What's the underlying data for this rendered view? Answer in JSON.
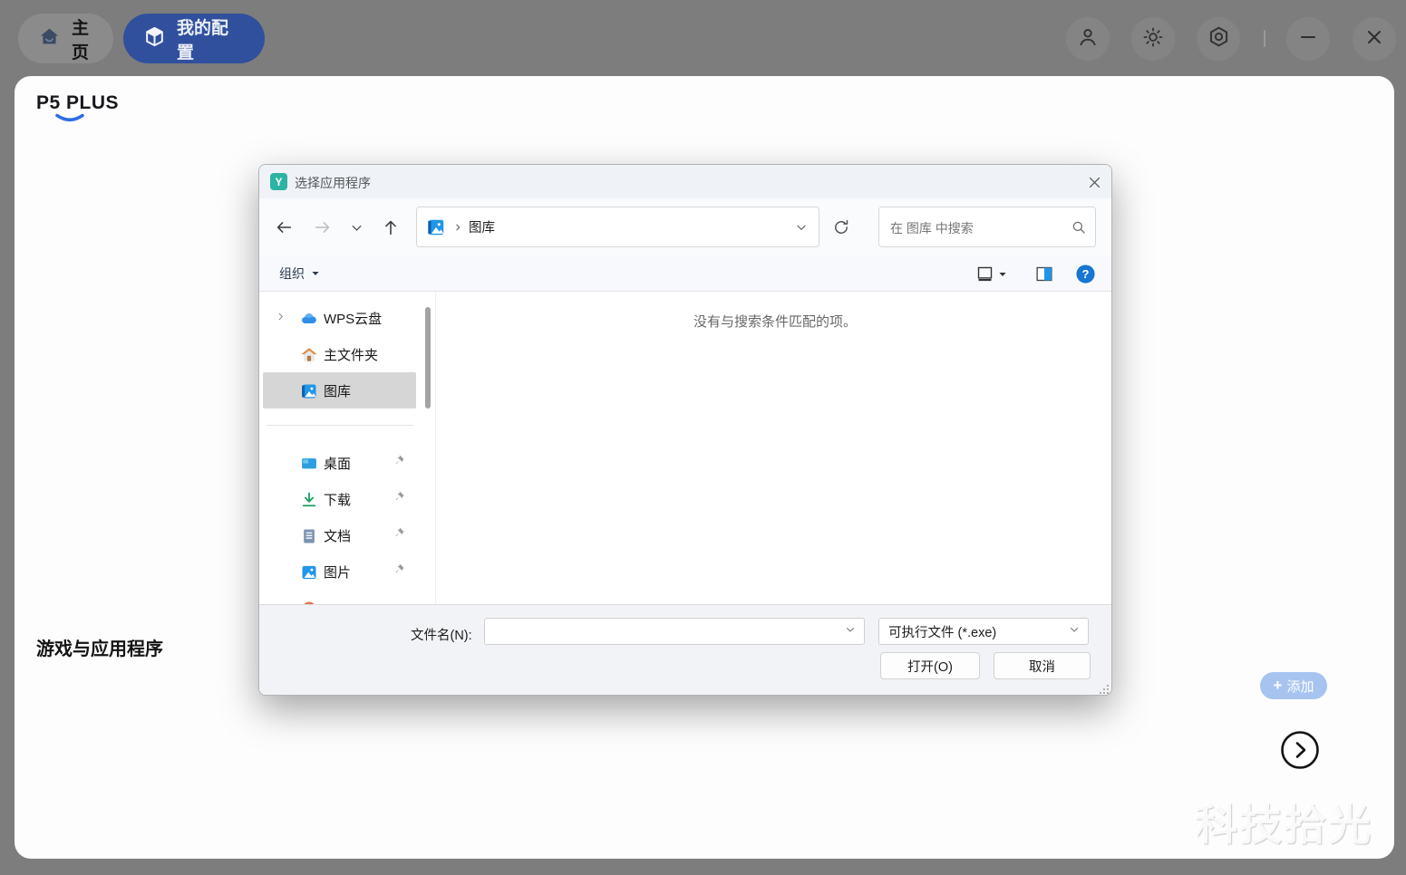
{
  "app": {
    "topbar": {
      "tabs": [
        {
          "label": "主页"
        },
        {
          "label": "我的配置"
        }
      ]
    },
    "page": {
      "title": "P5 PLUS",
      "section_label": "游戏与应用程序",
      "add_label": "添加",
      "add_plus": "+"
    },
    "watermark": "科技拾光"
  },
  "dialog": {
    "title": "选择应用程序",
    "address": {
      "location": "图库",
      "search_placeholder": "在 图库 中搜索"
    },
    "toolbar": {
      "organize_label": "组织"
    },
    "sidebar": {
      "items": [
        {
          "label": "WPS云盘"
        },
        {
          "label": "主文件夹"
        },
        {
          "label": "图库"
        },
        {
          "label": "桌面"
        },
        {
          "label": "下载"
        },
        {
          "label": "文档"
        },
        {
          "label": "图片"
        }
      ]
    },
    "content": {
      "empty_message": "没有与搜索条件匹配的项。"
    },
    "footer": {
      "filename_label": "文件名(N):",
      "filename_value": "",
      "filetype_value": "可执行文件 (*.exe)",
      "open_label": "打开(O)",
      "cancel_label": "取消"
    }
  },
  "colors": {
    "topbar_bg": "#7d7d7d",
    "active_tab_blue": "#30509e",
    "add_button_blue": "#a7c4f1",
    "selected_row_gray": "#d6d6d6",
    "help_blue": "#1676d2",
    "accent_underline_blue": "#2e6ce6",
    "app_icon_teal": "#2db3a4"
  }
}
